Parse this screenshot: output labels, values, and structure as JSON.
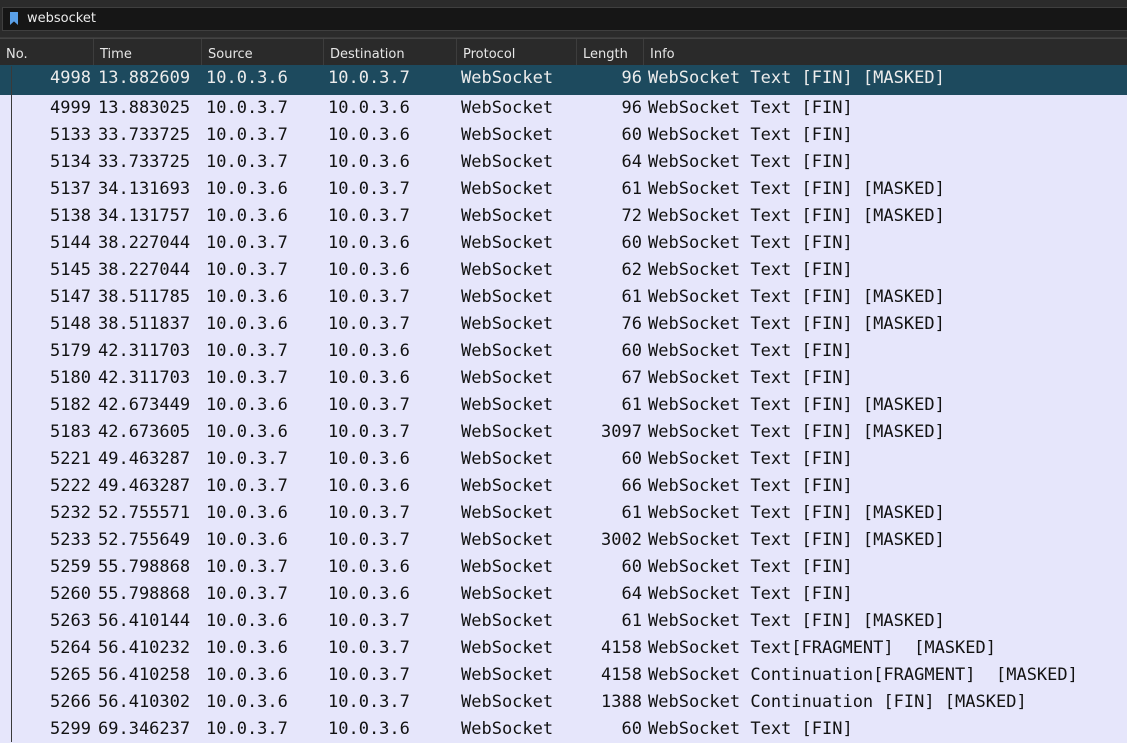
{
  "filter": {
    "value": "websocket",
    "icon": "bookmark-icon"
  },
  "columns": [
    "No.",
    "Time",
    "Source",
    "Destination",
    "Protocol",
    "Length",
    "Info"
  ],
  "colors": {
    "row_background": "#e6e6fb",
    "selected_row_background": "#1d4a5e",
    "header_background": "#2a2a2a"
  },
  "packets": [
    {
      "no": "4998",
      "time": "13.882609",
      "source": "10.0.3.6",
      "destination": "10.0.3.7",
      "protocol": "WebSocket",
      "length": "96",
      "info": "WebSocket Text [FIN] [MASKED]",
      "selected": true
    },
    {
      "no": "4999",
      "time": "13.883025",
      "source": "10.0.3.7",
      "destination": "10.0.3.6",
      "protocol": "WebSocket",
      "length": "96",
      "info": "WebSocket Text [FIN]"
    },
    {
      "no": "5133",
      "time": "33.733725",
      "source": "10.0.3.7",
      "destination": "10.0.3.6",
      "protocol": "WebSocket",
      "length": "60",
      "info": "WebSocket Text [FIN]"
    },
    {
      "no": "5134",
      "time": "33.733725",
      "source": "10.0.3.7",
      "destination": "10.0.3.6",
      "protocol": "WebSocket",
      "length": "64",
      "info": "WebSocket Text [FIN]"
    },
    {
      "no": "5137",
      "time": "34.131693",
      "source": "10.0.3.6",
      "destination": "10.0.3.7",
      "protocol": "WebSocket",
      "length": "61",
      "info": "WebSocket Text [FIN] [MASKED]"
    },
    {
      "no": "5138",
      "time": "34.131757",
      "source": "10.0.3.6",
      "destination": "10.0.3.7",
      "protocol": "WebSocket",
      "length": "72",
      "info": "WebSocket Text [FIN] [MASKED]"
    },
    {
      "no": "5144",
      "time": "38.227044",
      "source": "10.0.3.7",
      "destination": "10.0.3.6",
      "protocol": "WebSocket",
      "length": "60",
      "info": "WebSocket Text [FIN]"
    },
    {
      "no": "5145",
      "time": "38.227044",
      "source": "10.0.3.7",
      "destination": "10.0.3.6",
      "protocol": "WebSocket",
      "length": "62",
      "info": "WebSocket Text [FIN]"
    },
    {
      "no": "5147",
      "time": "38.511785",
      "source": "10.0.3.6",
      "destination": "10.0.3.7",
      "protocol": "WebSocket",
      "length": "61",
      "info": "WebSocket Text [FIN] [MASKED]"
    },
    {
      "no": "5148",
      "time": "38.511837",
      "source": "10.0.3.6",
      "destination": "10.0.3.7",
      "protocol": "WebSocket",
      "length": "76",
      "info": "WebSocket Text [FIN] [MASKED]"
    },
    {
      "no": "5179",
      "time": "42.311703",
      "source": "10.0.3.7",
      "destination": "10.0.3.6",
      "protocol": "WebSocket",
      "length": "60",
      "info": "WebSocket Text [FIN]"
    },
    {
      "no": "5180",
      "time": "42.311703",
      "source": "10.0.3.7",
      "destination": "10.0.3.6",
      "protocol": "WebSocket",
      "length": "67",
      "info": "WebSocket Text [FIN]"
    },
    {
      "no": "5182",
      "time": "42.673449",
      "source": "10.0.3.6",
      "destination": "10.0.3.7",
      "protocol": "WebSocket",
      "length": "61",
      "info": "WebSocket Text [FIN] [MASKED]"
    },
    {
      "no": "5183",
      "time": "42.673605",
      "source": "10.0.3.6",
      "destination": "10.0.3.7",
      "protocol": "WebSocket",
      "length": "3097",
      "info": "WebSocket Text [FIN] [MASKED]"
    },
    {
      "no": "5221",
      "time": "49.463287",
      "source": "10.0.3.7",
      "destination": "10.0.3.6",
      "protocol": "WebSocket",
      "length": "60",
      "info": "WebSocket Text [FIN]"
    },
    {
      "no": "5222",
      "time": "49.463287",
      "source": "10.0.3.7",
      "destination": "10.0.3.6",
      "protocol": "WebSocket",
      "length": "66",
      "info": "WebSocket Text [FIN]"
    },
    {
      "no": "5232",
      "time": "52.755571",
      "source": "10.0.3.6",
      "destination": "10.0.3.7",
      "protocol": "WebSocket",
      "length": "61",
      "info": "WebSocket Text [FIN] [MASKED]"
    },
    {
      "no": "5233",
      "time": "52.755649",
      "source": "10.0.3.6",
      "destination": "10.0.3.7",
      "protocol": "WebSocket",
      "length": "3002",
      "info": "WebSocket Text [FIN] [MASKED]"
    },
    {
      "no": "5259",
      "time": "55.798868",
      "source": "10.0.3.7",
      "destination": "10.0.3.6",
      "protocol": "WebSocket",
      "length": "60",
      "info": "WebSocket Text [FIN]"
    },
    {
      "no": "5260",
      "time": "55.798868",
      "source": "10.0.3.7",
      "destination": "10.0.3.6",
      "protocol": "WebSocket",
      "length": "64",
      "info": "WebSocket Text [FIN]"
    },
    {
      "no": "5263",
      "time": "56.410144",
      "source": "10.0.3.6",
      "destination": "10.0.3.7",
      "protocol": "WebSocket",
      "length": "61",
      "info": "WebSocket Text [FIN] [MASKED]"
    },
    {
      "no": "5264",
      "time": "56.410232",
      "source": "10.0.3.6",
      "destination": "10.0.3.7",
      "protocol": "WebSocket",
      "length": "4158",
      "info": "WebSocket Text[FRAGMENT]  [MASKED]"
    },
    {
      "no": "5265",
      "time": "56.410258",
      "source": "10.0.3.6",
      "destination": "10.0.3.7",
      "protocol": "WebSocket",
      "length": "4158",
      "info": "WebSocket Continuation[FRAGMENT]  [MASKED]"
    },
    {
      "no": "5266",
      "time": "56.410302",
      "source": "10.0.3.6",
      "destination": "10.0.3.7",
      "protocol": "WebSocket",
      "length": "1388",
      "info": "WebSocket Continuation [FIN] [MASKED]"
    },
    {
      "no": "5299",
      "time": "69.346237",
      "source": "10.0.3.7",
      "destination": "10.0.3.6",
      "protocol": "WebSocket",
      "length": "60",
      "info": "WebSocket Text [FIN]"
    }
  ]
}
